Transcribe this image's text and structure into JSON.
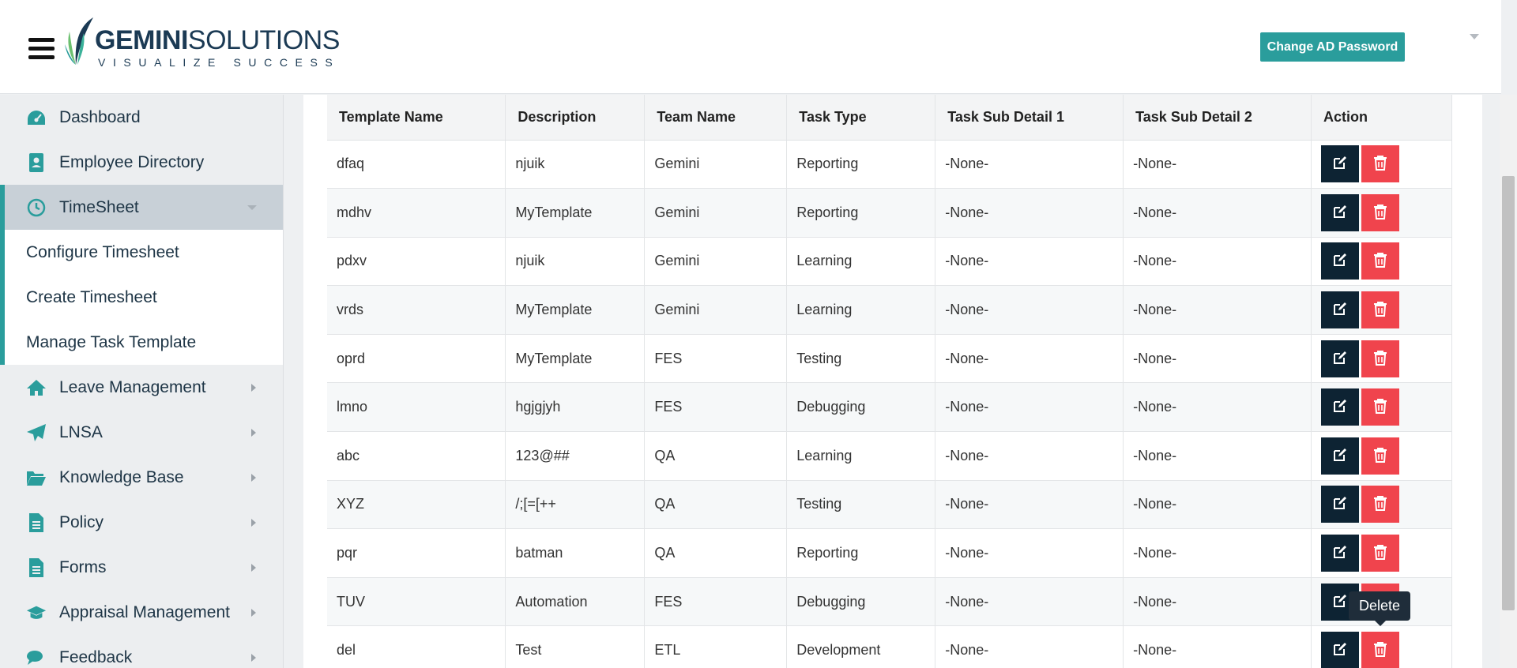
{
  "header": {
    "logo_main": "GEMINI",
    "logo_second": "SOLUTIONS",
    "logo_tagline": "VISUALIZE SUCCESS",
    "change_password_label": "Change AD Password"
  },
  "sidebar": {
    "items": [
      {
        "label": "Dashboard",
        "icon": "dashboard-icon"
      },
      {
        "label": "Employee Directory",
        "icon": "contact-book-icon"
      },
      {
        "label": "TimeSheet",
        "icon": "clock-icon"
      },
      {
        "label": "Leave Management",
        "icon": "home-icon"
      },
      {
        "label": "LNSA",
        "icon": "paper-plane-icon"
      },
      {
        "label": "Knowledge Base",
        "icon": "folder-open-icon"
      },
      {
        "label": "Policy",
        "icon": "document-icon"
      },
      {
        "label": "Forms",
        "icon": "form-icon"
      },
      {
        "label": "Appraisal Management",
        "icon": "graduation-cap-icon"
      },
      {
        "label": "Feedback",
        "icon": "chat-icon"
      }
    ],
    "timesheet_sub": [
      {
        "label": "Configure Timesheet"
      },
      {
        "label": "Create Timesheet"
      },
      {
        "label": "Manage Task Template"
      }
    ]
  },
  "table": {
    "headers": [
      "Template Name",
      "Description",
      "Team Name",
      "Task Type",
      "Task Sub Detail 1",
      "Task Sub Detail 2",
      "Action"
    ],
    "rows": [
      [
        "dfaq",
        "njuik",
        "Gemini",
        "Reporting",
        "-None-",
        "-None-"
      ],
      [
        "mdhv",
        "MyTemplate",
        "Gemini",
        "Reporting",
        "-None-",
        "-None-"
      ],
      [
        "pdxv",
        "njuik",
        "Gemini",
        "Learning",
        "-None-",
        "-None-"
      ],
      [
        "vrds",
        "MyTemplate",
        "Gemini",
        "Learning",
        "-None-",
        "-None-"
      ],
      [
        "oprd",
        "MyTemplate",
        "FES",
        "Testing",
        "-None-",
        "-None-"
      ],
      [
        "lmno",
        "hgjgjyh",
        "FES",
        "Debugging",
        "-None-",
        "-None-"
      ],
      [
        "abc",
        "123@##",
        "QA",
        "Learning",
        "-None-",
        "-None-"
      ],
      [
        "XYZ",
        "/;[=[++",
        "QA",
        "Testing",
        "-None-",
        "-None-"
      ],
      [
        "pqr",
        "batman",
        "QA",
        "Reporting",
        "-None-",
        "-None-"
      ],
      [
        "TUV",
        "Automation",
        "FES",
        "Debugging",
        "-None-",
        "-None-"
      ],
      [
        "del",
        "Test",
        "ETL",
        "Development",
        "-None-",
        "-None-"
      ]
    ]
  },
  "tooltip": {
    "text": "Delete"
  },
  "colors": {
    "accent": "#2a9d9c",
    "edit": "#0d2333",
    "delete": "#f0444d",
    "brand": "#1b3a54"
  }
}
